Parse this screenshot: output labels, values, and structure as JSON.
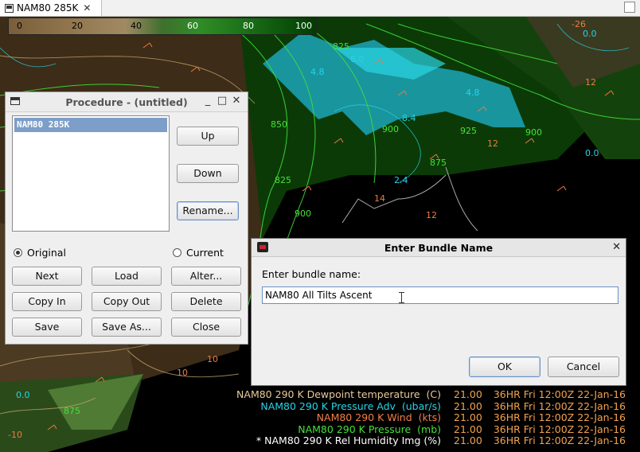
{
  "tab": {
    "label": "NAM80 285K"
  },
  "colorbar": {
    "ticks": [
      "0",
      "20",
      "40",
      "60",
      "80",
      "100"
    ]
  },
  "legend": [
    {
      "label": "NAM80 290 K Dewpoint temperature  (C)",
      "value": "21.00",
      "time": "36HR Fri 12:00Z 22-Jan-16",
      "color": "#e8c99a"
    },
    {
      "label": "NAM80 290 K Pressure Adv  (ubar/s)",
      "value": "21.00",
      "time": "36HR Fri 12:00Z 22-Jan-16",
      "color": "#27d3e6"
    },
    {
      "label": "NAM80 290 K Wind  (kts)",
      "value": "21.00",
      "time": "36HR Fri 12:00Z 22-Jan-16",
      "color": "#f0804a"
    },
    {
      "label": "NAM80 290 K Pressure  (mb)",
      "value": "21.00",
      "time": "36HR Fri 12:00Z 22-Jan-16",
      "color": "#44e236"
    },
    {
      "label": "* NAM80 290 K Rel Humidity Img (%)",
      "value": "21.00",
      "time": "36HR Fri 12:00Z 22-Jan-16",
      "color": "#ffffff"
    }
  ],
  "procedure": {
    "title": "Procedure - (untitled)",
    "items": [
      "NAM80 285K"
    ],
    "side_buttons": {
      "up": "Up",
      "down": "Down",
      "rename": "Rename..."
    },
    "radio_original": "Original",
    "radio_current": "Current",
    "buttons": {
      "next": "Next",
      "load": "Load",
      "alter": "Alter...",
      "copy_in": "Copy In",
      "copy_out": "Copy Out",
      "delete": "Delete",
      "save": "Save",
      "save_as": "Save As...",
      "close": "Close"
    }
  },
  "dialog": {
    "title": "Enter Bundle Name",
    "label": "Enter bundle name:",
    "value": "NAM80 All Tilts Ascent",
    "ok": "OK",
    "cancel": "Cancel"
  },
  "icons": {
    "tab_icon": "window-icon",
    "tab_close": "close-icon",
    "dialog_close": "close-icon"
  }
}
